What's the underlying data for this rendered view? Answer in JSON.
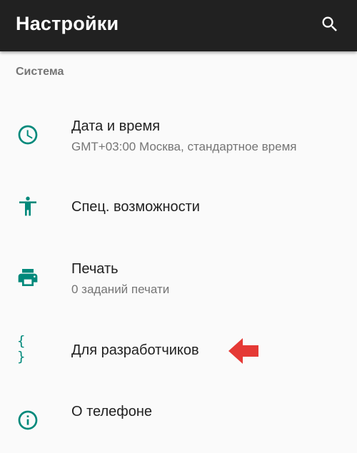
{
  "toolbar": {
    "title": "Настройки",
    "search_icon": "search-icon",
    "background_color": "#212121"
  },
  "section": {
    "header": "Система"
  },
  "accent_color": "#00897b",
  "items": [
    {
      "icon": "clock-icon",
      "title": "Дата и время",
      "subtitle": "GMT+03:00 Москва, стандартное время"
    },
    {
      "icon": "accessibility-icon",
      "title": "Спец. возможности",
      "subtitle": ""
    },
    {
      "icon": "printer-icon",
      "title": "Печать",
      "subtitle": "0 заданий печати"
    },
    {
      "icon": "braces-icon",
      "title": "Для разработчиков",
      "subtitle": "",
      "icon_text": "{ }"
    },
    {
      "icon": "info-icon",
      "title": "О телефоне",
      "subtitle": ""
    }
  ],
  "annotation": {
    "icon": "red-arrow-icon",
    "color": "#e53935"
  }
}
